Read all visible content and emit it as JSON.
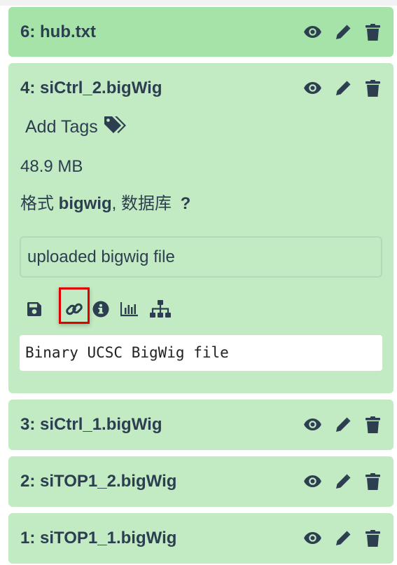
{
  "datasets": [
    {
      "title": "6: hub.txt"
    },
    {
      "title": "4: siCtrl_2.bigWig"
    },
    {
      "title": "3: siCtrl_1.bigWig"
    },
    {
      "title": "2: siTOP1_2.bigWig"
    },
    {
      "title": "1: siTOP1_1.bigWig"
    }
  ],
  "expanded": {
    "add_tags_label": "Add Tags",
    "size": "48.9 MB",
    "format_prefix": "格式 ",
    "format_value": "bigwig",
    "database_prefix": ", 数据库 ",
    "database_value": "?",
    "info": "uploaded bigwig file",
    "peek": "Binary UCSC BigWig file"
  },
  "icons": {
    "eye": "eye-icon",
    "edit": "pencil-icon",
    "delete": "trash-icon",
    "save": "save-icon",
    "link": "link-icon",
    "info": "info-icon",
    "visualize": "bar-chart-icon",
    "sitemap": "sitemap-icon",
    "tags": "tags-icon"
  },
  "colors": {
    "panel_ok": "#c3ebc3",
    "panel_header": "#a6e3a8",
    "text": "#2c3e50",
    "highlight": "#e00000"
  }
}
